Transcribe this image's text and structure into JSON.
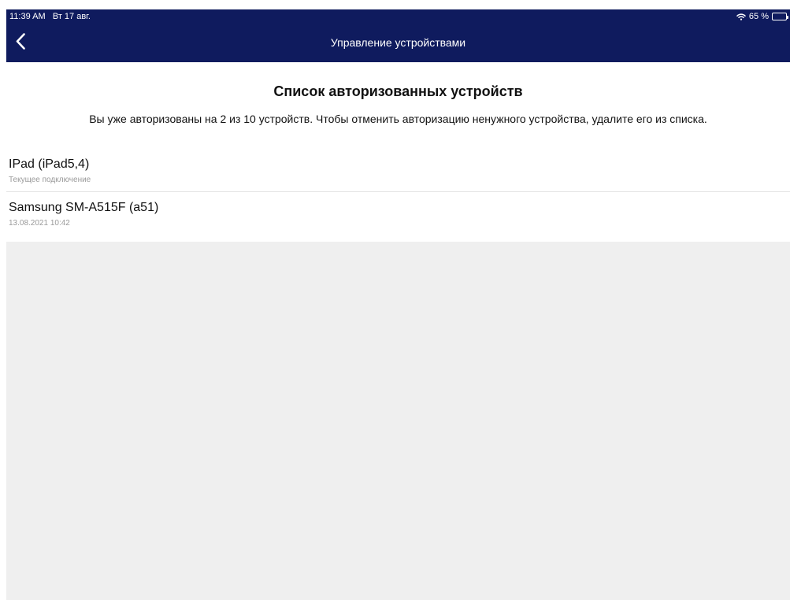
{
  "status_bar": {
    "time": "11:39 AM",
    "date": "Вт 17 авг.",
    "battery_text": "65 %",
    "battery_level": 0.65,
    "icons": [
      "wifi-icon",
      "battery-icon"
    ]
  },
  "nav": {
    "back_icon": "chevron-left-icon",
    "title": "Управление устройствами"
  },
  "main": {
    "title": "Список авторизованных устройств",
    "description": "Вы уже авторизованы на 2 из 10 устройств. Чтобы отменить авторизацию ненужного устройства, удалите его из списка."
  },
  "devices": [
    {
      "name": "IPad (iPad5,4)",
      "subtitle": "Текущее подключение"
    },
    {
      "name": "Samsung SM-A515F (a51)",
      "subtitle": "13.08.2021 10:42"
    }
  ],
  "colors": {
    "header_bg": "#0f1b5e",
    "page_bg": "#efefef",
    "content_bg": "#ffffff",
    "primary_text": "#111111",
    "secondary_text": "#9a9a9a"
  }
}
